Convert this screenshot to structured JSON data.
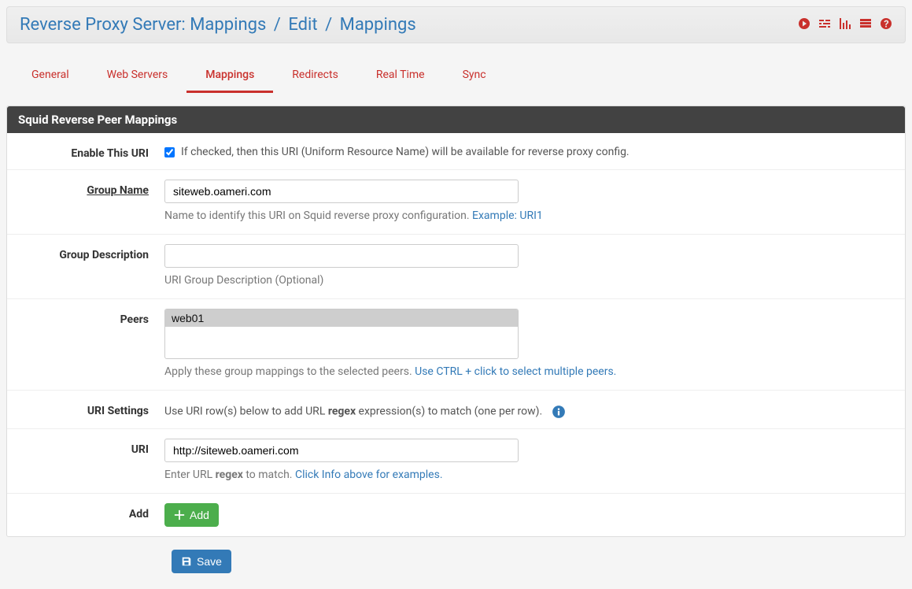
{
  "breadcrumb": {
    "part1": "Reverse Proxy Server: Mappings",
    "part2": "Edit",
    "part3": "Mappings"
  },
  "tabs": {
    "general": "General",
    "webservers": "Web Servers",
    "mappings": "Mappings",
    "redirects": "Redirects",
    "realtime": "Real Time",
    "sync": "Sync"
  },
  "section": {
    "title": "Squid Reverse Peer Mappings"
  },
  "form": {
    "enable": {
      "label": "Enable This URI",
      "checked": true,
      "desc": "If checked, then this URI (Uniform Resource Name) will be available for reverse proxy config."
    },
    "groupname": {
      "label": "Group Name",
      "value": "siteweb.oameri.com",
      "help_pre": "Name to identify this URI on Squid reverse proxy configuration. ",
      "help_link": "Example: URI1"
    },
    "groupdesc": {
      "label": "Group Description",
      "value": "",
      "help": "URI Group Description (Optional)"
    },
    "peers": {
      "label": "Peers",
      "options": [
        "web01"
      ],
      "help_pre": "Apply these group mappings to the selected peers. ",
      "help_link": "Use CTRL + click to select multiple peers."
    },
    "urisettings": {
      "label": "URI Settings",
      "text_pre": "Use URI row(s) below to add URL ",
      "text_bold": "regex",
      "text_post": " expression(s) to match (one per row)."
    },
    "uri": {
      "label": "URI",
      "value": "http://siteweb.oameri.com",
      "help_pre": "Enter URL ",
      "help_bold": "regex",
      "help_mid": " to match. ",
      "help_link": "Click Info above for examples."
    },
    "add": {
      "label": "Add",
      "button": "Add"
    },
    "save": {
      "button": "Save"
    }
  }
}
